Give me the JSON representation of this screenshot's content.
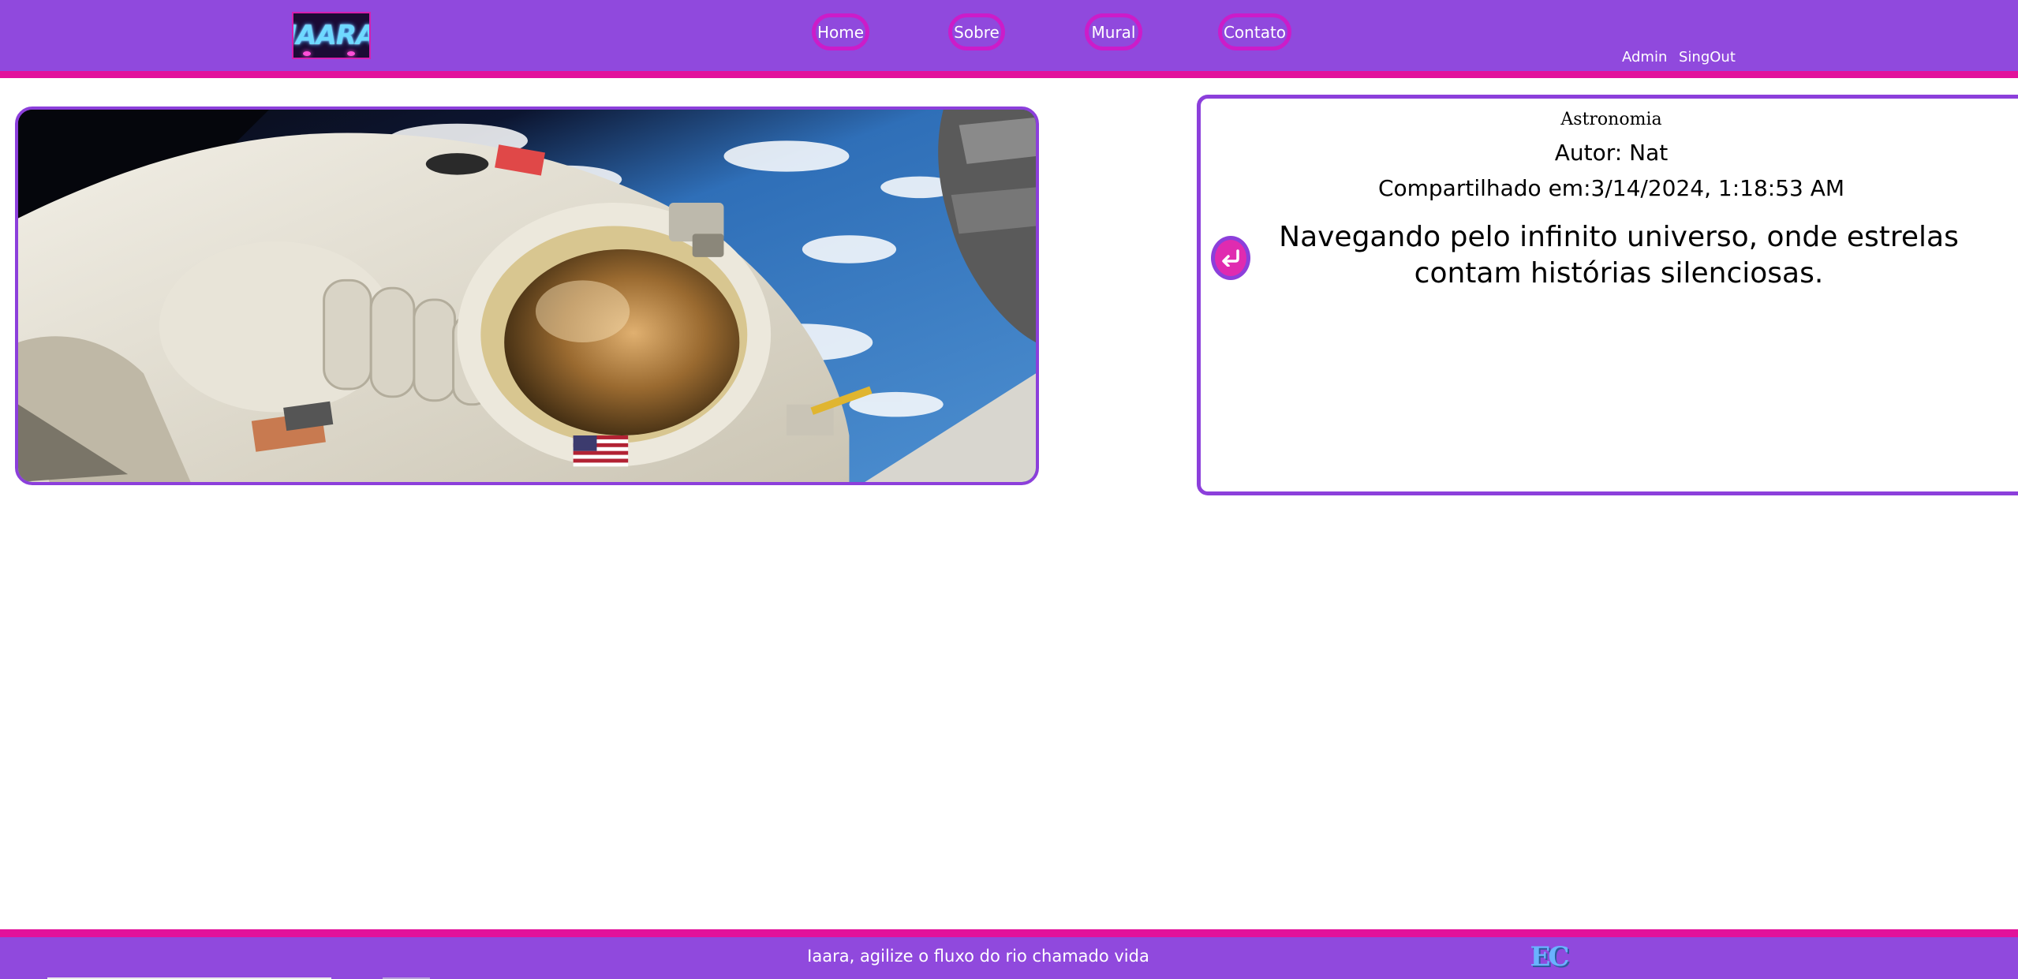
{
  "header": {
    "logo_text": "IAARA",
    "nav": [
      {
        "label": "Home"
      },
      {
        "label": "Sobre"
      },
      {
        "label": "Mural"
      },
      {
        "label": "Contato"
      }
    ],
    "links": {
      "admin": "Admin",
      "singout": "SingOut"
    }
  },
  "post": {
    "image_icon": "astronaut-photo",
    "category": "Astronomia",
    "author": "Autor: Nat",
    "shared": "Compartilhado em:3/14/2024, 1:18:53 AM",
    "text": "Navegando pelo infinito universo, onde estrelas contam histórias silenciosas.",
    "back_icon": "return-arrow-icon"
  },
  "footer": {
    "slogan": "Iaara, agilize o fluxo do rio chamado vida",
    "logo_text": "EC"
  },
  "colors": {
    "header_bg": "#9049dd",
    "stripe": "#e2119b",
    "card_border": "#8c3fdb",
    "nav_border": "#cc1cc9"
  }
}
